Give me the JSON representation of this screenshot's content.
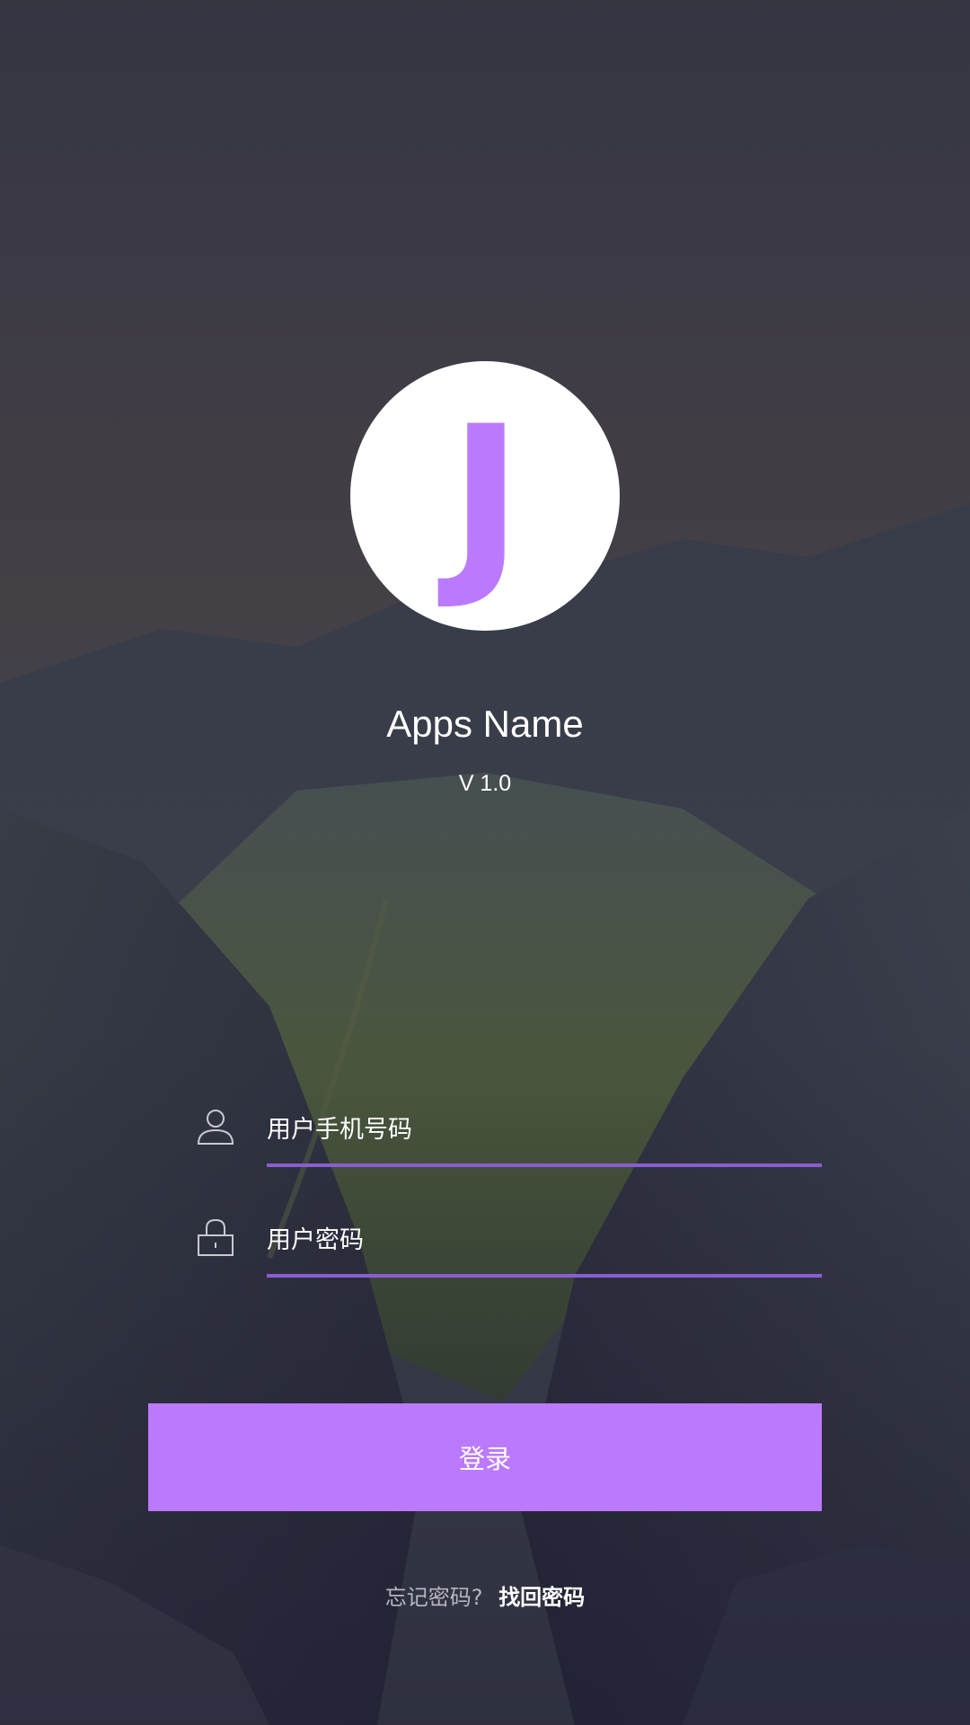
{
  "logo": {
    "letter": "J"
  },
  "app": {
    "name": "Apps Name",
    "version": "V 1.0"
  },
  "login_form": {
    "phone_placeholder": "用户手机号码",
    "phone_icon": "user-icon",
    "password_placeholder": "用户密码",
    "password_icon": "lock-icon",
    "submit_label": "登录"
  },
  "forgot": {
    "label": "忘记密码?",
    "link_label": "找回密码"
  },
  "colors": {
    "accent": "#bb7afd",
    "underline": "#8a5ed0",
    "text": "#ffffff",
    "muted_text": "#b7b5c2"
  }
}
